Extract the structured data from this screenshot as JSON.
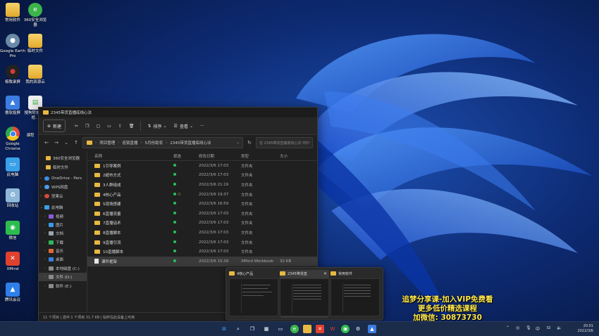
{
  "desktop": {
    "icons": [
      {
        "label": "常用软件",
        "glyph": "folder",
        "color": "#e8b842"
      },
      {
        "label": "Google Earth Pro",
        "glyph": "globe",
        "color": "#6a8aa8"
      },
      {
        "label": "极致录屏",
        "glyph": "rec",
        "color": "#d43c3c"
      },
      {
        "label": "傲软投屏",
        "glyph": "cast",
        "color": "#3b7de0"
      },
      {
        "label": "Google Chrome",
        "glyph": "chrome",
        "color": "#e14b3b"
      },
      {
        "label": "此电脑",
        "glyph": "pc",
        "color": "#3aa0e8"
      },
      {
        "label": "回收站",
        "glyph": "bin",
        "color": "#8fb8d8"
      },
      {
        "label": "微信",
        "glyph": "wechat",
        "color": "#2dbd4e"
      },
      {
        "label": "XMind",
        "glyph": "X",
        "color": "#e0412e"
      },
      {
        "label": "腾讯会议",
        "glyph": "meet",
        "color": "#2f7fe8"
      },
      {
        "label": "360安全浏览器",
        "glyph": "e",
        "color": "#3bb44a"
      },
      {
        "label": "临时文件",
        "glyph": "folder",
        "color": "#e8b842"
      },
      {
        "label": "我的资源云",
        "glyph": "folder",
        "color": "#e8b842"
      },
      {
        "label": "搜狗转护天1框...",
        "glyph": "doc",
        "color": "#3bb44a"
      },
      {
        "label": "课程",
        "glyph": "folder",
        "color": "#e8b842"
      }
    ]
  },
  "explorer": {
    "title": "2345带货直播底线心法",
    "toolbar": {
      "new_label": "新建",
      "sort_label": "排序",
      "view_label": "查看",
      "more_label": "···"
    },
    "breadcrumb": [
      "项目管理",
      "连锁直播",
      "5月份助农",
      "2345带货直播底线心法"
    ],
    "search_placeholder": "在 2345带货直播底线心法 中搜索",
    "nav": [
      {
        "label": "360安全浏览器",
        "kind": "folder"
      },
      {
        "label": "临时文件",
        "kind": "folder"
      },
      {
        "label": "OneDrive - Pers",
        "kind": "cloud"
      },
      {
        "label": "WPS网盘",
        "kind": "cloud"
      },
      {
        "label": "坚果云",
        "kind": "cloud"
      },
      {
        "label": "此电脑",
        "kind": "pc"
      },
      {
        "label": "视频",
        "kind": "lib"
      },
      {
        "label": "图片",
        "kind": "lib"
      },
      {
        "label": "文档",
        "kind": "lib"
      },
      {
        "label": "下载",
        "kind": "lib"
      },
      {
        "label": "音乐",
        "kind": "lib"
      },
      {
        "label": "桌面",
        "kind": "lib"
      },
      {
        "label": "本地磁盘 (C:)",
        "kind": "drive"
      },
      {
        "label": "文件 (D:)",
        "kind": "drive"
      },
      {
        "label": "软件 (E:)",
        "kind": "drive"
      }
    ],
    "columns": {
      "name": "名称",
      "status": "状态",
      "date": "修改日期",
      "type": "类型",
      "size": "大小"
    },
    "files": [
      {
        "name": "1引导案例",
        "date": "2022/3/6 17:03",
        "type": "文件夹",
        "size": "",
        "kind": "folder"
      },
      {
        "name": "2超市方式",
        "date": "2022/3/6 17:03",
        "type": "文件夹",
        "size": "",
        "kind": "folder"
      },
      {
        "name": "3人群组成",
        "date": "2022/3/6 21:19",
        "type": "文件夹",
        "size": "",
        "kind": "folder"
      },
      {
        "name": "4核心产品",
        "date": "2022/3/6 19:37",
        "type": "文件夹",
        "size": "",
        "kind": "folder"
      },
      {
        "name": "5现场搭建",
        "date": "2022/3/6 16:59",
        "type": "文件夹",
        "size": "",
        "kind": "folder"
      },
      {
        "name": "6直播流量",
        "date": "2022/3/6 17:03",
        "type": "文件夹",
        "size": "",
        "kind": "folder"
      },
      {
        "name": "7直播话术",
        "date": "2022/3/6 17:03",
        "type": "文件夹",
        "size": "",
        "kind": "folder"
      },
      {
        "name": "8直播脚本",
        "date": "2022/3/6 17:03",
        "type": "文件夹",
        "size": "",
        "kind": "folder"
      },
      {
        "name": "9直播引流",
        "date": "2022/3/6 17:03",
        "type": "文件夹",
        "size": "",
        "kind": "folder"
      },
      {
        "name": "10直播脚本",
        "date": "2022/3/6 17:03",
        "type": "文件夹",
        "size": "",
        "kind": "folder"
      },
      {
        "name": "课件框架",
        "date": "2022/3/6 15:39",
        "type": "XMind Workbook",
        "size": "32 KB",
        "kind": "xmind"
      }
    ],
    "status_text": "11 个项目 | 选中 1 个项目 31.7 KB | 始终在此设备上可用",
    "accent": "#27c15a"
  },
  "thumbnails": [
    {
      "title": "4核心产品"
    },
    {
      "title": "2345带货直"
    },
    {
      "title": "常用软件"
    }
  ],
  "promo": {
    "line1": "追梦分享课-加入VIP免费看",
    "line2": "更多低价精选课程",
    "line3": "加微信: 30873730"
  },
  "taskbar": {
    "time": "20:01",
    "date": "2022/3/6",
    "tray_lang": "中"
  }
}
